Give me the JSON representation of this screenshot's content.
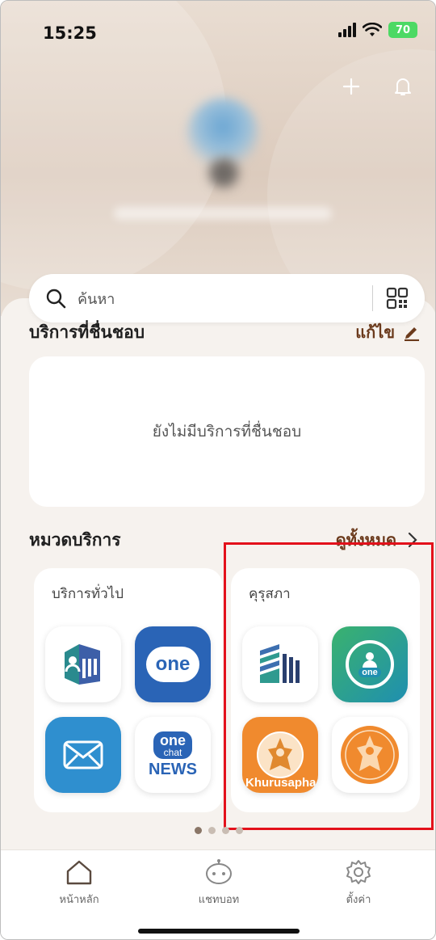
{
  "status_bar": {
    "time": "15:25",
    "battery": "70"
  },
  "search": {
    "placeholder": "ค้นหา"
  },
  "favorites": {
    "title": "บริการที่ชื่นชอบ",
    "edit_label": "แก้ไข",
    "empty_text": "ยังไม่มีบริการที่ชื่นชอบ"
  },
  "categories": {
    "title": "หมวดบริการ",
    "view_all_label": "ดูทั้งหมด",
    "cards": [
      {
        "title": "บริการทั่วไป",
        "apps": [
          "building-app-icon",
          "one-app-icon",
          "mail-app-icon",
          "onechat-news-app-icon"
        ],
        "news_top": "one",
        "news_mid": "chat",
        "news_bottom": "NEWS",
        "one_label": "one"
      },
      {
        "title": "คุรุสภา",
        "apps": [
          "stack-app-icon",
          "one-id-app-icon",
          "khurusapha-app-icon",
          "khurusapha-seal-app-icon"
        ],
        "khurusapha_label": "Khurusapha",
        "one_label": "one"
      }
    ]
  },
  "pager": {
    "count": 4,
    "active": 0
  },
  "tabs": [
    {
      "label": "หน้าหลัก",
      "icon": "home-icon"
    },
    {
      "label": "แชทบอท",
      "icon": "chatbot-icon"
    },
    {
      "label": "ตั้งค่า",
      "icon": "gear-icon"
    }
  ],
  "colors": {
    "accent": "#6b3a1c",
    "highlight": "#e3111b",
    "battery": "#4cd964"
  }
}
